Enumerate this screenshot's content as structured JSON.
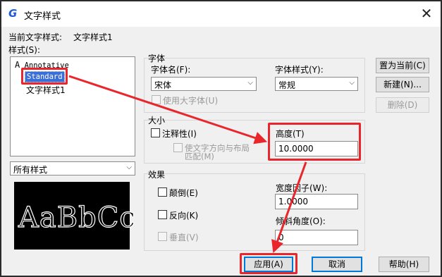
{
  "title": "文字样式",
  "current_style": {
    "label": "当前文字样式:",
    "value": "文字样式1"
  },
  "styles_label": "样式(S):",
  "styles": [
    "Annotative",
    "Standard",
    "文字样式1"
  ],
  "selected_style": "Standard",
  "filter": {
    "value": "所有样式"
  },
  "preview_text": "AaBbCc",
  "font": {
    "group_label": "字体",
    "name_label": "字体名(F):",
    "name_value": "宋体",
    "style_label": "字体样式(Y):",
    "style_value": "常规",
    "bigfont_label": "使用大字体(U)",
    "bigfont_checked": false
  },
  "size": {
    "group_label": "大小",
    "annotative_label": "注释性(I)",
    "annotative_checked": false,
    "match_orientation_line1": "使文字方向与布局",
    "match_orientation_line2": "匹配(M)",
    "height_label": "高度(T)",
    "height_value": "10.0000"
  },
  "effects": {
    "group_label": "效果",
    "upside_down_label": "颠倒(E)",
    "backwards_label": "反向(K)",
    "vertical_label": "垂直(V)",
    "width_factor_label": "宽度因子(W):",
    "width_factor_value": "1.0000",
    "oblique_label": "倾斜角度(O):",
    "oblique_value": "0"
  },
  "buttons": {
    "set_current": "置为当前(C)",
    "new": "新建(N)...",
    "delete": "删除(D)",
    "apply": "应用(A)",
    "cancel": "取消",
    "help": "帮助(H)"
  },
  "colors": {
    "annotation": "#e8262b",
    "selection": "#3a6fd8",
    "focus": "#0078d7"
  }
}
